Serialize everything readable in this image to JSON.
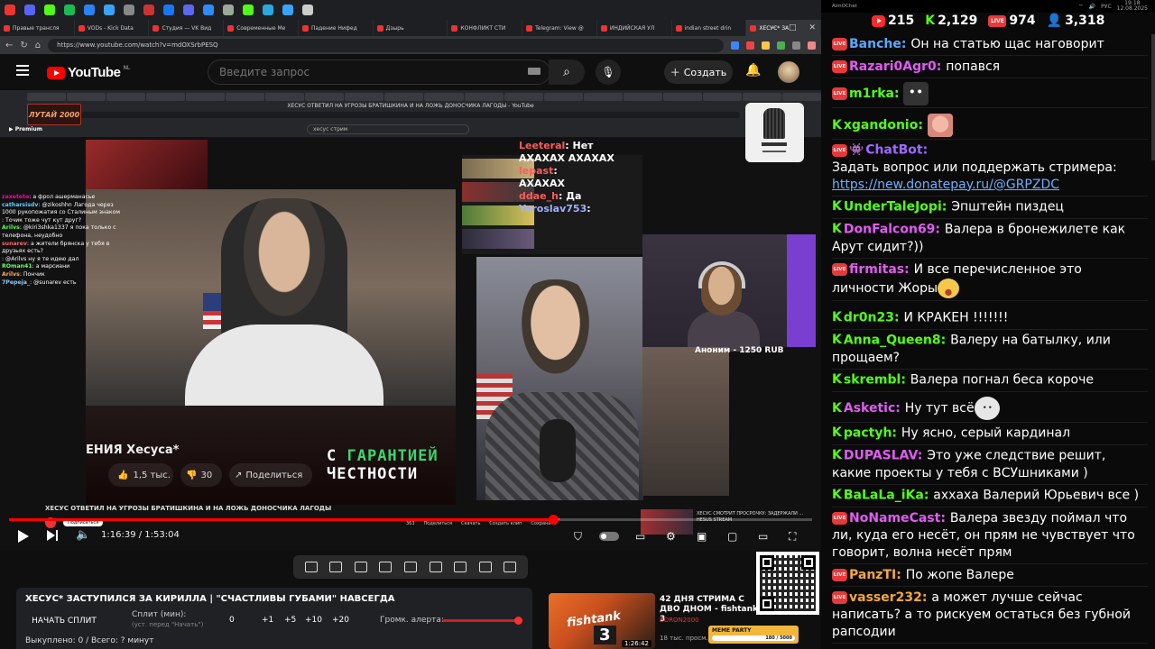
{
  "browser": {
    "pinned_tab_colors": [
      "#e33",
      "#5865f2",
      "#53fc18",
      "#1db954",
      "#2b82f5",
      "#3aa3ff",
      "#888",
      "#c33",
      "#1877f2",
      "#5b67f5",
      "#2a8cff",
      "#9a9",
      "#53fc18",
      "#2aa8e0",
      "#3aa3ff",
      "#ccc"
    ],
    "tabs": [
      {
        "label": "Правые трансля",
        "active": false
      },
      {
        "label": "VODs - Kick Data",
        "active": false
      },
      {
        "label": "Студия — VK Вид",
        "active": false
      },
      {
        "label": "Современные Ме",
        "active": false
      },
      {
        "label": "Падение Нифед",
        "active": false
      },
      {
        "label": "Дзырь",
        "active": false
      },
      {
        "label": "КОНФЛИКТ СТИ",
        "active": false
      },
      {
        "label": "Telegram: View @",
        "active": false
      },
      {
        "label": "ИНДИЙСКАЯ УЛ",
        "active": false
      },
      {
        "label": "indian street drin",
        "active": false
      },
      {
        "label": "ХЕСУС* ЗА",
        "active": true
      }
    ],
    "window_controls": [
      "–",
      "□",
      "✕"
    ],
    "url": "https://www.youtube.com/watch?v=mdOXSrbPESQ"
  },
  "youtube": {
    "logo_text": "YouTube",
    "region": "NL",
    "search_placeholder": "Введите запрос",
    "create_label": "Создать"
  },
  "video": {
    "inner_title": "ХЕСУС ОТВЕТИЛ НА УГРОЗЫ БРАТИШКИНА И НА ЛОЖЬ ДОНОСЧИКА ЛАГОДЫ - YouTube",
    "inner_search": "хесус стрим",
    "premium_label": "Premium",
    "lutai_logo": "ЛУТАЙ 2000",
    "inner_chat": [
      {
        "user": "zaxetete",
        "text": ": а фрол ашерманасье"
      },
      {
        "user": "catharsisdv",
        "text": ": @zikoshhn Лагода через 1000 рукопожатия со Сталиным знаком"
      },
      {
        "user": "",
        "text": ": Точик тоже чут кут друг?"
      },
      {
        "user": "Arilvs",
        "text": ": @kiri3shka1337 я пока только с телефона, неудобно"
      },
      {
        "user": "sunarev",
        "text": ": а жители брянска у тебя в друзьях есть?"
      },
      {
        "user": "",
        "text": ": @Arilvs ну я те идею дал"
      },
      {
        "user": "ROman41",
        "text": ": а марсиани"
      },
      {
        "user": "Arilvs",
        "text": ": Пончик"
      },
      {
        "user": "",
        "text": ""
      },
      {
        "user": "7Pepeja_",
        "text": ": @sunarev есть"
      }
    ],
    "overlay_chat": [
      {
        "user": "Leeteral",
        "text": ": Нет"
      },
      {
        "user": "",
        "text": "АХАХАХ АХАХАХ"
      },
      {
        "user": "lepast",
        "text": ":"
      },
      {
        "user": "",
        "text": "АХАХАХ"
      },
      {
        "user": "ddae_h",
        "text": ": Да"
      },
      {
        "user": "Yaroslav753",
        "text": ":"
      }
    ],
    "caption_left": "ЕНИЯ Хесуса*",
    "like_count": "1,5 тыс.",
    "dislike_count": "30",
    "share_label": "Поделиться",
    "guarantee_line1_pre": "С ",
    "guarantee_line1_hl": "ГАРАНТИЕЙ",
    "guarantee_line2": "ЧЕСТНОСТИ",
    "donation_text": "Аноним - 1250 RUB",
    "inner_bottom_title": "ХЕСУС ОТВЕТИЛ НА УГРОЗЫ БРАТИШКИНА И НА ЛОЖЬ ДОНОСЧИКА ЛАГОДЫ",
    "inner_channel_subscribe": "Подписаться",
    "inner_actions": [
      "363",
      "Поделиться",
      "Скачать",
      "Создать клип",
      "Сохранить"
    ],
    "inner_mini_title": "ХЕСУС СМОТРИТ ПРОСРОЧКУ: ЗАДЕРЖАЛИ ...",
    "inner_mini_meta": "HESUS STREAM"
  },
  "player": {
    "current_time": "1:16:39",
    "total_time": "1:53:04",
    "progress": 0.678
  },
  "split": {
    "title": "ХЕСУС* ЗАСТУПИЛСЯ ЗА КИРИЛЛА | \"СЧАСТЛИВЫ ГУБАМИ\" НАВСЕГДА",
    "start_label": "НАЧАТЬ СПЛИТ",
    "split_label": "Сплит (мин):",
    "split_hint": "(уст. перед \"Начать\")",
    "values": [
      "0",
      "+1",
      "+5",
      "+10",
      "+20"
    ],
    "alert_label": "Громк. алерта:",
    "alert_level": 0.95,
    "footer": "Выкуплено: 0 / Всего: ? минут"
  },
  "recommendation": {
    "title": "42 ДНЯ СТРИМА С ДВО ДНОМ - fishtank 3",
    "channel": "BORON2000",
    "meta": "18 тыс. просм.",
    "duration": "1:26:42",
    "thumb_text": "fishtank",
    "thumb_number": "3"
  },
  "meme_party": {
    "label": "MEME PARTY",
    "counter": "180 / 5000"
  },
  "chat": {
    "tray_app": "AimOChat",
    "tray_lang": "РУС",
    "tray_time": "19:18",
    "tray_date": "12.08.2025",
    "stats": {
      "youtube_viewers": "215",
      "kick_viewers": "2,129",
      "vk_viewers": "974",
      "total_viewers": "3,318"
    },
    "colors": {
      "kick_green": "#53fc18",
      "live_red": "#e8393a",
      "link_blue": "#6fb0ff"
    },
    "messages": [
      {
        "platform": "live",
        "user": "Banche",
        "color": "#5aa9ff",
        "text": "Он на статью щас наговорит",
        "emote": ""
      },
      {
        "platform": "live",
        "user": "Razari0Agr0",
        "color": "#e05cf0",
        "text": "попався",
        "emote": ""
      },
      {
        "platform": "live",
        "user": "m1rka",
        "color": "#53fc18",
        "text": "",
        "emote": "cat"
      },
      {
        "platform": "kick",
        "user": "xgandonio",
        "color": "#53fc18",
        "text": "",
        "emote": "face"
      },
      {
        "platform": "bot",
        "user": "ChatBot",
        "color": "#9b6bff",
        "text": "Задать вопрос или поддержать стримера:",
        "link": "https://new.donatepay.ru/@GRPZDC",
        "emote": ""
      },
      {
        "platform": "kick",
        "user": "UnderTaleJopi",
        "color": "#53fc18",
        "text": "Эпштейн пиздец",
        "emote": ""
      },
      {
        "platform": "kick",
        "user": "DonFalcon69",
        "color": "#e05cf0",
        "text": "Валера в бронежилете как Арут сидит?))",
        "emote": ""
      },
      {
        "platform": "live",
        "user": "firmitas",
        "color": "#e05cf0",
        "text": "И все перечисленное это личности Жоры",
        "emote": "laugh"
      },
      {
        "platform": "kick",
        "user": "dr0n23",
        "color": "#53fc18",
        "text": "И КРАКЕН !!!!!!!",
        "emote": ""
      },
      {
        "platform": "kick",
        "user": "Anna_Queen8",
        "color": "#53fc18",
        "text": "Валеру на батылку, или прощаем?",
        "emote": ""
      },
      {
        "platform": "kick",
        "user": "skrembl",
        "color": "#53fc18",
        "text": "Валера погнал беса короче",
        "emote": ""
      },
      {
        "platform": "kick",
        "user": "Asketic",
        "color": "#e05cf0",
        "text": "Ну тут всё",
        "emote": "white"
      },
      {
        "platform": "kick",
        "user": "pactyh",
        "color": "#53fc18",
        "text": "Ну ясно, серый кардинал",
        "emote": ""
      },
      {
        "platform": "kick",
        "user": "DUPASLAV",
        "color": "#e05cf0",
        "text": "Это уже следствие решит, какие проекты у тебя с ВСУшниками )",
        "emote": ""
      },
      {
        "platform": "kick",
        "user": "BaLaLa_iKa",
        "color": "#53fc18",
        "text": "аххаха Валерий Юрьевич все )",
        "emote": ""
      },
      {
        "platform": "live",
        "user": "NoNameCast",
        "color": "#e05cf0",
        "text": "Валера звезду поймал что ли, куда его несёт, он прям не чувствует что говорит, волна несёт прям",
        "emote": ""
      },
      {
        "platform": "live",
        "user": "PanzTI",
        "color": "#f5a83a",
        "text": "По жопе Валере",
        "emote": ""
      },
      {
        "platform": "live",
        "user": "vasser232",
        "color": "#f5a83a",
        "text": "а может лучше сейчас написать? а то рискуем остаться без губной рапсодии",
        "emote": ""
      }
    ]
  }
}
